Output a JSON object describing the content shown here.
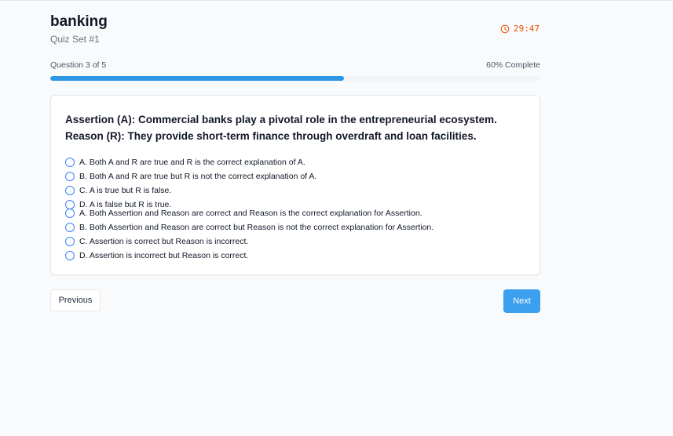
{
  "header": {
    "title": "banking",
    "subtitle": "Quiz Set #1",
    "timer": "29:47",
    "timer_icon": "clock-icon"
  },
  "progress": {
    "question_label": "Question 3 of 5",
    "percent_label": "60% Complete",
    "value": 0.6
  },
  "question": {
    "text": "Assertion (A): Commercial banks play a pivotal role in the entrepreneurial ecosystem. Reason (R): They provide short-term finance through overdraft and loan facilities.",
    "options": [
      "A. Both A and R are true and R is the correct explanation of A.",
      "B. Both A and R are true but R is not the correct explanation of A.",
      "C. A is true but R is false.",
      "D. A is false but R is true.",
      "A. Both Assertion and Reason are correct and Reason is the correct explanation for Assertion.",
      "B. Both Assertion and Reason are correct but Reason is not the correct explanation for Assertion.",
      "C. Assertion is correct but Reason is incorrect.",
      "D. Assertion is incorrect but Reason is correct."
    ]
  },
  "nav": {
    "previous_label": "Previous",
    "next_label": "Next"
  },
  "colors": {
    "accent": "#2c98e5",
    "next_button": "#3ba0ef",
    "timer": "#ea580c",
    "radio_border": "#3b82f6"
  }
}
